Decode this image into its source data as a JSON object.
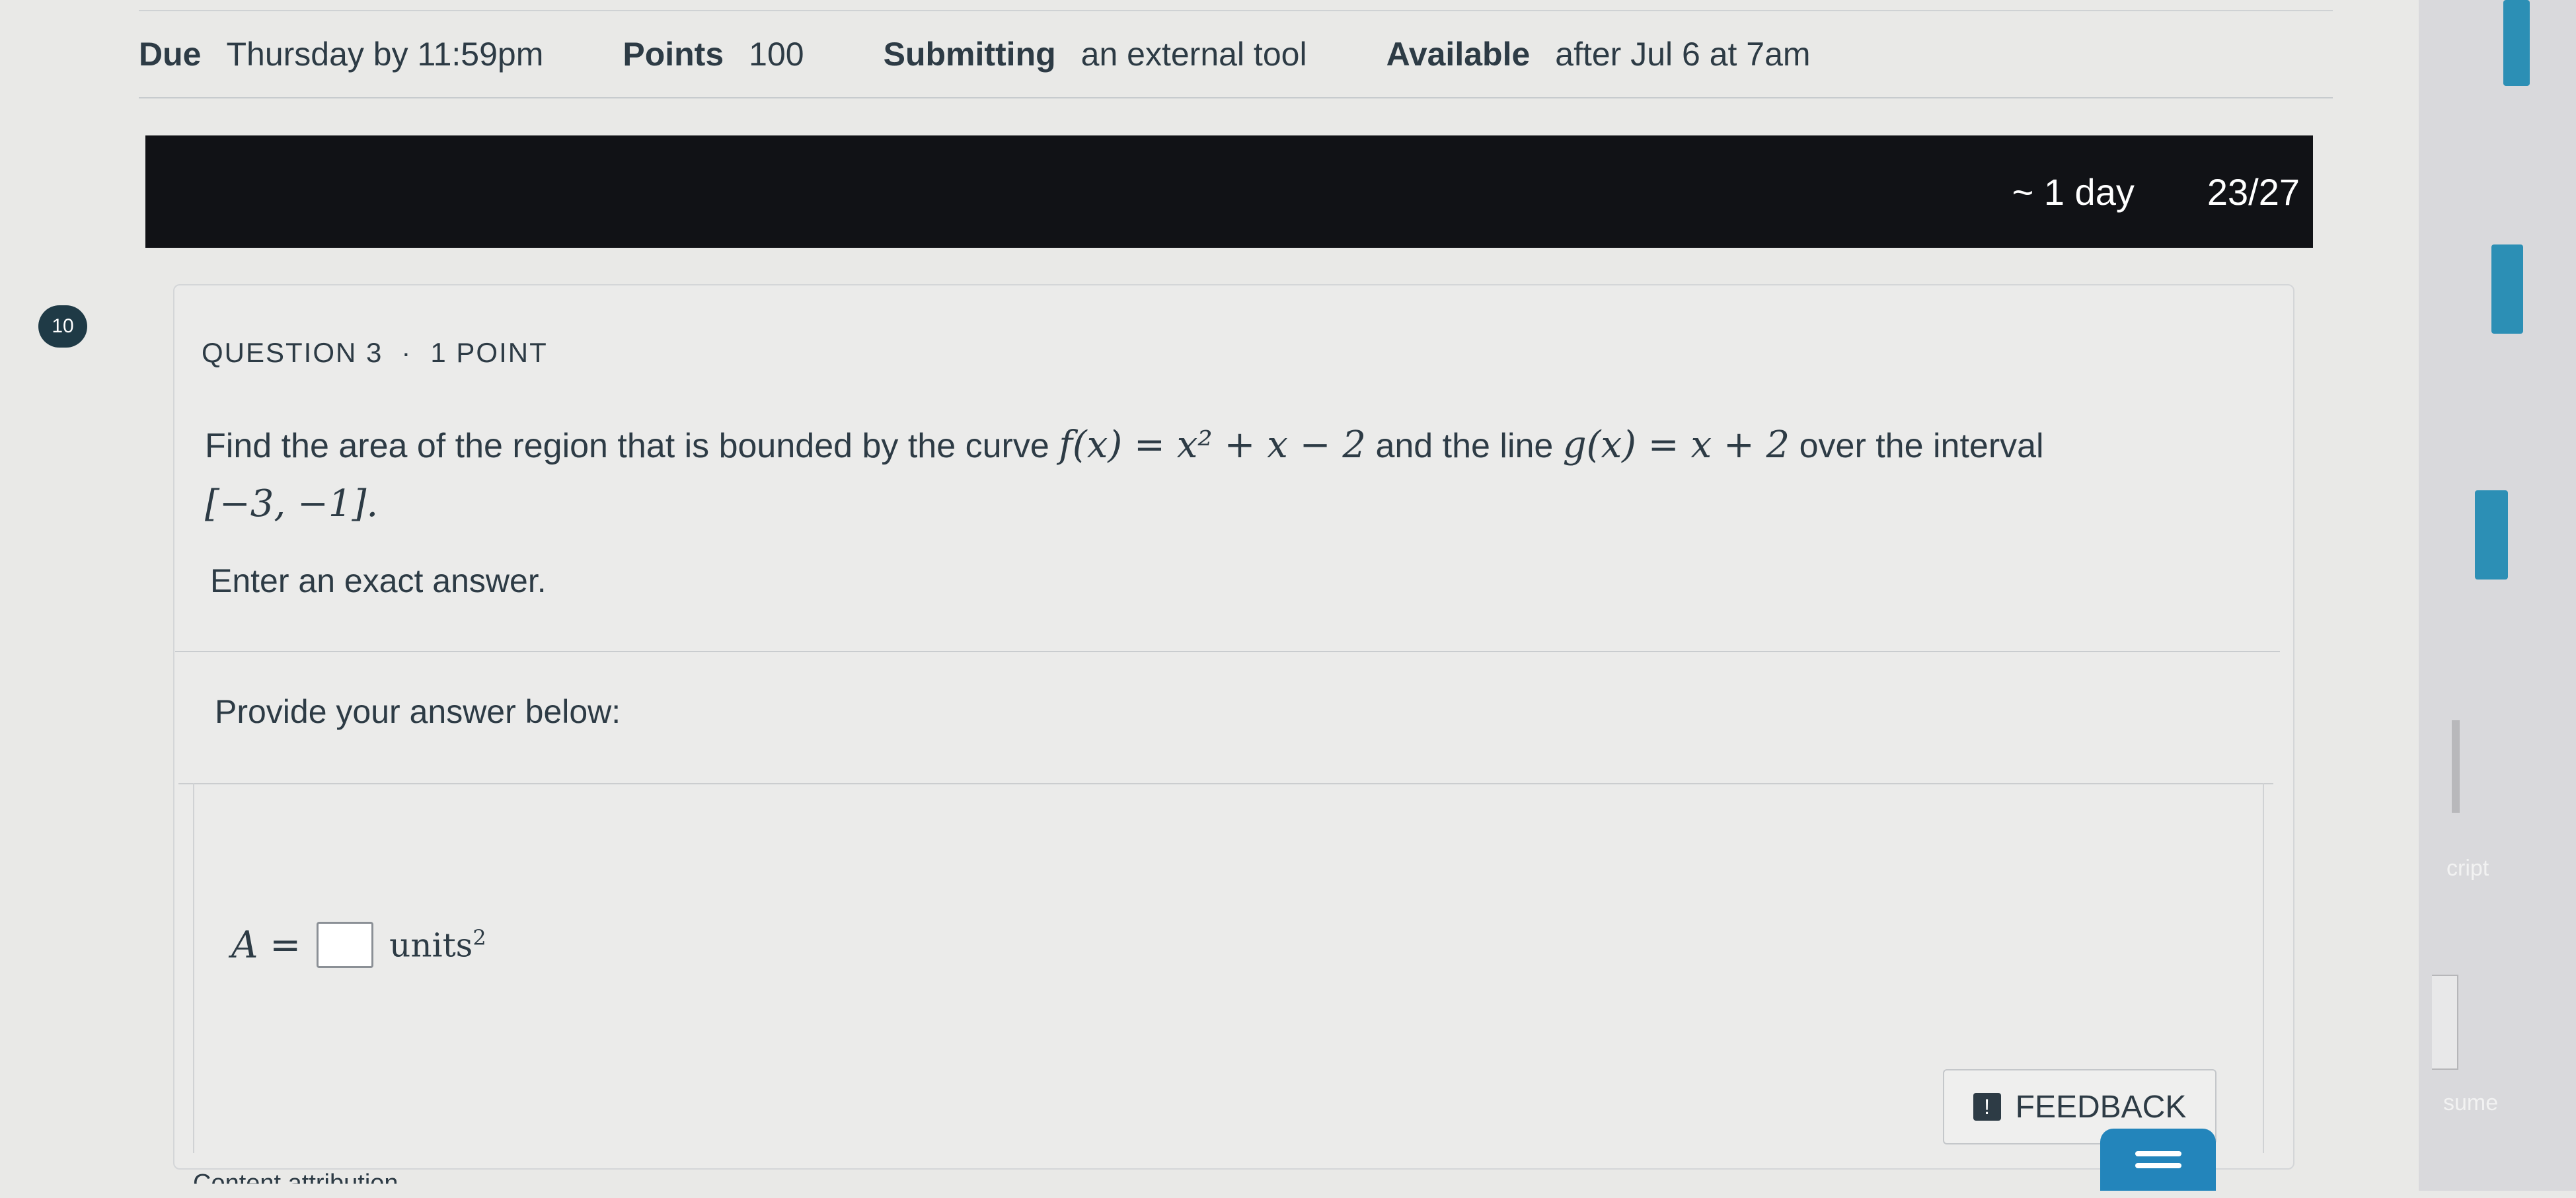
{
  "meta": {
    "due_label": "Due",
    "due_value": "Thursday by 11:59pm",
    "points_label": "Points",
    "points_value": "100",
    "submitting_label": "Submitting",
    "submitting_value": "an external tool",
    "available_label": "Available",
    "available_value": "after Jul 6 at 7am"
  },
  "timer": {
    "time_left": "~ 1 day",
    "progress": "23/27"
  },
  "question": {
    "badge": "10",
    "number_label": "QUESTION 3",
    "separator": "·",
    "points_label": "1 POINT",
    "prompt_text_1": "Find the area of the region that is bounded by the curve ",
    "prompt_math_1": "f(x) = x² + x − 2",
    "prompt_text_2": " and the line ",
    "prompt_math_2": "g(x) = x + 2",
    "prompt_text_3": " over the interval",
    "prompt_math_3": "[−3, −1].",
    "instruction": "Enter an exact answer."
  },
  "answer": {
    "section_label": "Provide your answer below:",
    "variable": "A =",
    "units": "units",
    "units_exponent": "2"
  },
  "feedback": {
    "label": "FEEDBACK",
    "icon": "feedback-icon"
  },
  "footer": {
    "attribution": "Content attribution"
  },
  "side_panel": {
    "label_1": "cript",
    "label_2": "sume"
  }
}
